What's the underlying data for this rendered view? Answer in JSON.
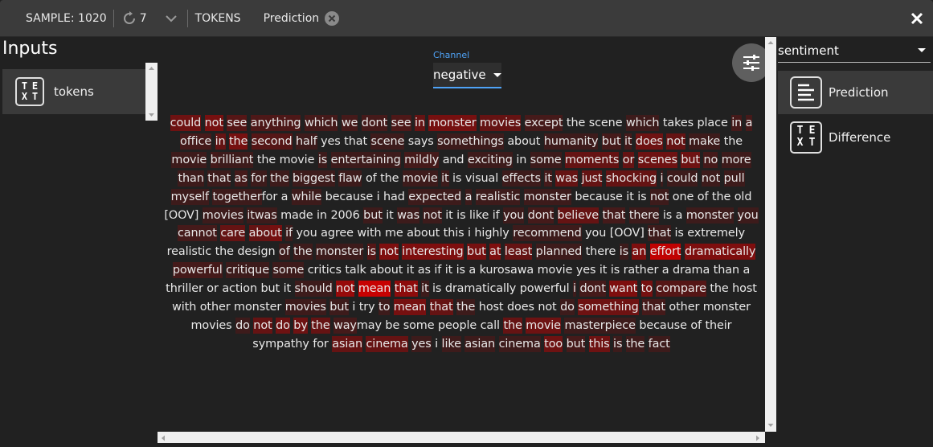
{
  "topbar": {
    "sample": "SAMPLE: 1020",
    "refresh_count": "7",
    "tokens_label": "TOKENS",
    "prediction_label": "Prediction"
  },
  "inputs": {
    "title": "Inputs",
    "tokens_icon_letters": [
      "T",
      "E",
      "X",
      "T"
    ],
    "tokens_label": "tokens"
  },
  "channel": {
    "label": "Channel",
    "value": "negative"
  },
  "right": {
    "select_value": "sentiment",
    "prediction_label": "Prediction",
    "difference_label": "Difference"
  },
  "colors": {
    "panel_bg": "#212121",
    "topbar_bg": "#3b3b3b",
    "selected_row": "#3a3a3a",
    "accent": "#4fa3f7",
    "highlight": "#cc0000"
  },
  "tokens": [
    [
      "could",
      0.35
    ],
    [
      " ",
      0
    ],
    [
      "not",
      0.4
    ],
    [
      " ",
      0
    ],
    [
      "see",
      0.2
    ],
    [
      " ",
      0
    ],
    [
      "anything",
      0.15
    ],
    [
      " ",
      0
    ],
    [
      "which",
      0.1
    ],
    [
      " ",
      0
    ],
    [
      "we",
      0.1
    ],
    [
      " ",
      0
    ],
    [
      "dont",
      0.1
    ],
    [
      " ",
      0
    ],
    [
      "see",
      0.15
    ],
    [
      " ",
      0
    ],
    [
      "in",
      0.3
    ],
    [
      " ",
      0
    ],
    [
      "monster",
      0.4
    ],
    [
      " ",
      0
    ],
    [
      "movies",
      0.3
    ],
    [
      " ",
      0
    ],
    [
      "except",
      0.1
    ],
    [
      " ",
      0
    ],
    [
      "the",
      0
    ],
    [
      " ",
      0
    ],
    [
      "scene",
      0
    ],
    [
      " ",
      0
    ],
    [
      "which",
      0.05
    ],
    [
      " ",
      0
    ],
    [
      "takes",
      0
    ],
    [
      " ",
      0
    ],
    [
      "place",
      0
    ],
    [
      " ",
      0
    ],
    [
      "in",
      0.1
    ],
    [
      " ",
      0
    ],
    [
      "a",
      0.1
    ],
    [
      " ",
      0
    ],
    [
      "of",
      0.1
    ],
    [
      "fice",
      0.1
    ],
    [
      " ",
      0
    ],
    [
      "in",
      0.3
    ],
    [
      " ",
      0
    ],
    [
      "the",
      0.4
    ],
    [
      " ",
      0
    ],
    [
      "second",
      0.2
    ],
    [
      " ",
      0
    ],
    [
      "half",
      0.05
    ],
    [
      " ",
      0
    ],
    [
      "yes",
      0
    ],
    [
      " ",
      0
    ],
    [
      "that",
      0
    ],
    [
      " ",
      0
    ],
    [
      "scene",
      0.05
    ],
    [
      " ",
      0
    ],
    [
      "says",
      0
    ],
    [
      " ",
      0
    ],
    [
      "somethings",
      0.05
    ],
    [
      " ",
      0
    ],
    [
      "about",
      0
    ],
    [
      " ",
      0
    ],
    [
      "humanity",
      0.05
    ],
    [
      " ",
      0
    ],
    [
      "but",
      0.1
    ],
    [
      " ",
      0
    ],
    [
      "it",
      0.1
    ],
    [
      " ",
      0
    ],
    [
      "does",
      0.35
    ],
    [
      " ",
      0
    ],
    [
      "not",
      0.3
    ],
    [
      " ",
      0
    ],
    [
      "make",
      0.05
    ],
    [
      " ",
      0
    ],
    [
      "the",
      0
    ],
    [
      " ",
      0
    ],
    [
      "movie",
      0.05
    ],
    [
      " ",
      0
    ],
    [
      "b",
      0.1
    ],
    [
      "rilliant",
      0.05
    ],
    [
      " ",
      0
    ],
    [
      "the",
      0
    ],
    [
      " ",
      0
    ],
    [
      "movie",
      0
    ],
    [
      " ",
      0
    ],
    [
      "is",
      0.05
    ],
    [
      " ",
      0
    ],
    [
      "entertaining",
      0.05
    ],
    [
      " ",
      0
    ],
    [
      "mildly",
      0.1
    ],
    [
      " ",
      0
    ],
    [
      "and",
      0
    ],
    [
      " ",
      0
    ],
    [
      "exciting",
      0.05
    ],
    [
      " ",
      0
    ],
    [
      "in",
      0
    ],
    [
      " ",
      0
    ],
    [
      "some",
      0.05
    ],
    [
      " ",
      0
    ],
    [
      "moments",
      0.3
    ],
    [
      " ",
      0
    ],
    [
      "or",
      0.3
    ],
    [
      " ",
      0
    ],
    [
      "scenes",
      0.35
    ],
    [
      " ",
      0
    ],
    [
      "but",
      0.35
    ],
    [
      " ",
      0
    ],
    [
      "no",
      0.1
    ],
    [
      " ",
      0
    ],
    [
      "more",
      0.05
    ],
    [
      " ",
      0
    ],
    [
      "than",
      0.05
    ],
    [
      " ",
      0
    ],
    [
      "that",
      0.05
    ],
    [
      " ",
      0
    ],
    [
      "a",
      0.1
    ],
    [
      "s",
      0.1
    ],
    [
      " ",
      0
    ],
    [
      "for",
      0.05
    ],
    [
      " ",
      0
    ],
    [
      "the",
      0.05
    ],
    [
      " ",
      0
    ],
    [
      "biggest",
      0.05
    ],
    [
      " ",
      0
    ],
    [
      "flaw",
      0.05
    ],
    [
      " ",
      0
    ],
    [
      "of",
      0
    ],
    [
      " ",
      0
    ],
    [
      "the",
      0
    ],
    [
      " ",
      0
    ],
    [
      "movie",
      0.05
    ],
    [
      " ",
      0
    ],
    [
      "it",
      0.05
    ],
    [
      " ",
      0
    ],
    [
      "is",
      0
    ],
    [
      " ",
      0
    ],
    [
      "visual",
      0
    ],
    [
      " ",
      0
    ],
    [
      "effects",
      0.05
    ],
    [
      " ",
      0
    ],
    [
      "it",
      0.1
    ],
    [
      " ",
      0
    ],
    [
      "was",
      0.3
    ],
    [
      " ",
      0
    ],
    [
      "just",
      0.3
    ],
    [
      " ",
      0
    ],
    [
      "shocking",
      0.3
    ],
    [
      " ",
      0
    ],
    [
      "i",
      0.05
    ],
    [
      " ",
      0
    ],
    [
      "could",
      0.05
    ],
    [
      " ",
      0
    ],
    [
      "not",
      0.05
    ],
    [
      " ",
      0
    ],
    [
      "pull",
      0.05
    ],
    [
      " ",
      0
    ],
    [
      "myself",
      0.05
    ],
    [
      " ",
      0
    ],
    [
      "together",
      0.05
    ],
    [
      "for",
      0
    ],
    [
      " ",
      0
    ],
    [
      "a",
      0
    ],
    [
      " ",
      0
    ],
    [
      "while",
      0.05
    ],
    [
      " ",
      0
    ],
    [
      "because",
      0
    ],
    [
      " ",
      0
    ],
    [
      "i",
      0
    ],
    [
      " ",
      0
    ],
    [
      "had",
      0
    ],
    [
      " ",
      0
    ],
    [
      "expected",
      0.05
    ],
    [
      " ",
      0
    ],
    [
      "a",
      0.05
    ],
    [
      " ",
      0
    ],
    [
      "realistic",
      0.05
    ],
    [
      " ",
      0
    ],
    [
      "monster",
      0.05
    ],
    [
      " ",
      0
    ],
    [
      "because",
      0
    ],
    [
      " ",
      0
    ],
    [
      "it",
      0
    ],
    [
      " ",
      0
    ],
    [
      "is",
      0
    ],
    [
      " ",
      0
    ],
    [
      "not",
      0.05
    ],
    [
      " ",
      0
    ],
    [
      "one",
      0
    ],
    [
      " ",
      0
    ],
    [
      "of",
      0
    ],
    [
      " ",
      0
    ],
    [
      "the",
      0
    ],
    [
      " ",
      0
    ],
    [
      "old",
      0
    ],
    [
      " ",
      0
    ],
    [
      "[OOV]",
      0
    ],
    [
      " ",
      0
    ],
    [
      "movies",
      0.05
    ],
    [
      " ",
      0
    ],
    [
      "it",
      0.05
    ],
    [
      "was",
      0.05
    ],
    [
      " ",
      0
    ],
    [
      "made",
      0
    ],
    [
      " ",
      0
    ],
    [
      "in",
      0
    ],
    [
      " ",
      0
    ],
    [
      "2006",
      0
    ],
    [
      " ",
      0
    ],
    [
      "but",
      0.05
    ],
    [
      " ",
      0
    ],
    [
      "it",
      0
    ],
    [
      " ",
      0
    ],
    [
      "was",
      0.05
    ],
    [
      " ",
      0
    ],
    [
      "not",
      0.05
    ],
    [
      " ",
      0
    ],
    [
      "it",
      0
    ],
    [
      " ",
      0
    ],
    [
      "is",
      0
    ],
    [
      " ",
      0
    ],
    [
      "like",
      0
    ],
    [
      " ",
      0
    ],
    [
      "if",
      0
    ],
    [
      " ",
      0
    ],
    [
      "you",
      0.05
    ],
    [
      " ",
      0
    ],
    [
      "dont",
      0.1
    ],
    [
      " ",
      0
    ],
    [
      "believe",
      0.3
    ],
    [
      " ",
      0
    ],
    [
      "that",
      0.1
    ],
    [
      " ",
      0
    ],
    [
      "there",
      0.05
    ],
    [
      " ",
      0
    ],
    [
      "is",
      0
    ],
    [
      " ",
      0
    ],
    [
      "a",
      0
    ],
    [
      " ",
      0
    ],
    [
      "monster",
      0.05
    ],
    [
      " ",
      0
    ],
    [
      "you",
      0.05
    ],
    [
      " ",
      0
    ],
    [
      "cannot",
      0.1
    ],
    [
      " ",
      0
    ],
    [
      "care",
      0.3
    ],
    [
      " ",
      0
    ],
    [
      "abo",
      0.3
    ],
    [
      "ut",
      0.4
    ],
    [
      " ",
      0
    ],
    [
      "if",
      0.05
    ],
    [
      " ",
      0
    ],
    [
      "you",
      0
    ],
    [
      " ",
      0
    ],
    [
      "agree",
      0
    ],
    [
      " ",
      0
    ],
    [
      "with",
      0
    ],
    [
      " ",
      0
    ],
    [
      "me",
      0
    ],
    [
      " ",
      0
    ],
    [
      "about",
      0
    ],
    [
      " ",
      0
    ],
    [
      "this",
      0
    ],
    [
      " ",
      0
    ],
    [
      "i",
      0
    ],
    [
      " ",
      0
    ],
    [
      "highly",
      0
    ],
    [
      " ",
      0
    ],
    [
      "recommend",
      0.05
    ],
    [
      " ",
      0
    ],
    [
      "you",
      0
    ],
    [
      " ",
      0
    ],
    [
      "[OOV]",
      0
    ],
    [
      " ",
      0
    ],
    [
      "that",
      0.05
    ],
    [
      " ",
      0
    ],
    [
      "is",
      0
    ],
    [
      " ",
      0
    ],
    [
      "extremely",
      0
    ],
    [
      " ",
      0
    ],
    [
      "realistic",
      0
    ],
    [
      " ",
      0
    ],
    [
      "the",
      0
    ],
    [
      " ",
      0
    ],
    [
      "design",
      0
    ],
    [
      " ",
      0
    ],
    [
      "o",
      0.05
    ],
    [
      "f",
      0.05
    ],
    [
      " ",
      0
    ],
    [
      "the",
      0.05
    ],
    [
      " ",
      0
    ],
    [
      "monster",
      0.05
    ],
    [
      " ",
      0
    ],
    [
      "is",
      0.2
    ],
    [
      " ",
      0
    ],
    [
      "not",
      0.45
    ],
    [
      " ",
      0
    ],
    [
      "interesting",
      0.45
    ],
    [
      " ",
      0
    ],
    [
      "but",
      0.4
    ],
    [
      " ",
      0
    ],
    [
      "at",
      0.45
    ],
    [
      " ",
      0
    ],
    [
      "least",
      0.3
    ],
    [
      " ",
      0
    ],
    [
      "planned",
      0.05
    ],
    [
      " ",
      0
    ],
    [
      "there",
      0
    ],
    [
      " ",
      0
    ],
    [
      "is",
      0.05
    ],
    [
      " ",
      0
    ],
    [
      "an",
      0.45
    ],
    [
      " ",
      0
    ],
    [
      "effort",
      0.85
    ],
    [
      " ",
      0
    ],
    [
      "dramatically",
      0.45
    ],
    [
      " ",
      0
    ],
    [
      "powerful",
      0.1
    ],
    [
      " ",
      0
    ],
    [
      "critique",
      0.05
    ],
    [
      " ",
      0
    ],
    [
      "som",
      0.05
    ],
    [
      "e",
      0.05
    ],
    [
      " ",
      0
    ],
    [
      "critics",
      0
    ],
    [
      " ",
      0
    ],
    [
      "talk",
      0
    ],
    [
      " ",
      0
    ],
    [
      "about",
      0
    ],
    [
      " ",
      0
    ],
    [
      "it",
      0
    ],
    [
      " ",
      0
    ],
    [
      "as",
      0
    ],
    [
      " ",
      0
    ],
    [
      "if",
      0
    ],
    [
      " ",
      0
    ],
    [
      "it",
      0
    ],
    [
      " ",
      0
    ],
    [
      "is",
      0
    ],
    [
      " ",
      0
    ],
    [
      "a",
      0
    ],
    [
      " ",
      0
    ],
    [
      "kurosawa",
      0
    ],
    [
      " ",
      0
    ],
    [
      "movie",
      0
    ],
    [
      " ",
      0
    ],
    [
      "yes",
      0
    ],
    [
      " ",
      0
    ],
    [
      "it",
      0
    ],
    [
      " ",
      0
    ],
    [
      "is",
      0
    ],
    [
      " ",
      0
    ],
    [
      "rather",
      0
    ],
    [
      " ",
      0
    ],
    [
      "a",
      0
    ],
    [
      " ",
      0
    ],
    [
      "drama",
      0
    ],
    [
      " ",
      0
    ],
    [
      "than",
      0
    ],
    [
      " ",
      0
    ],
    [
      "a",
      0
    ],
    [
      " ",
      0
    ],
    [
      "thriller",
      0
    ],
    [
      " ",
      0
    ],
    [
      "or",
      0
    ],
    [
      " ",
      0
    ],
    [
      "action",
      0
    ],
    [
      " ",
      0
    ],
    [
      "but",
      0
    ],
    [
      " ",
      0
    ],
    [
      "it",
      0
    ],
    [
      " ",
      0
    ],
    [
      "sho",
      0.05
    ],
    [
      "uld",
      0.05
    ],
    [
      " ",
      0
    ],
    [
      "not",
      0.6
    ],
    [
      " ",
      0
    ],
    [
      "mean",
      0.9
    ],
    [
      " ",
      0
    ],
    [
      "that",
      0.55
    ],
    [
      " ",
      0
    ],
    [
      "it",
      0.05
    ],
    [
      " ",
      0
    ],
    [
      "is",
      0
    ],
    [
      " ",
      0
    ],
    [
      "dramatically",
      0
    ],
    [
      " ",
      0
    ],
    [
      "powerful",
      0
    ],
    [
      " ",
      0
    ],
    [
      "i",
      0.05
    ],
    [
      " ",
      0
    ],
    [
      "dont",
      0.1
    ],
    [
      " ",
      0
    ],
    [
      "want",
      0.45
    ],
    [
      " ",
      0
    ],
    [
      "to",
      0.4
    ],
    [
      " ",
      0
    ],
    [
      "compare",
      0.2
    ],
    [
      " ",
      0
    ],
    [
      "the",
      0
    ],
    [
      " ",
      0
    ],
    [
      "host",
      0
    ],
    [
      " ",
      0
    ],
    [
      "with",
      0
    ],
    [
      " ",
      0
    ],
    [
      "other",
      0
    ],
    [
      " ",
      0
    ],
    [
      "monster",
      0
    ],
    [
      " ",
      0
    ],
    [
      "movie",
      0.05
    ],
    [
      "s",
      0.05
    ],
    [
      " ",
      0
    ],
    [
      "but",
      0.05
    ],
    [
      " ",
      0
    ],
    [
      "i",
      0
    ],
    [
      " ",
      0
    ],
    [
      "try",
      0
    ],
    [
      " ",
      0
    ],
    [
      "to",
      0.05
    ],
    [
      " ",
      0
    ],
    [
      "mean",
      0.4
    ],
    [
      " ",
      0
    ],
    [
      "that",
      0.3
    ],
    [
      " ",
      0
    ],
    [
      "the",
      0.05
    ],
    [
      " ",
      0
    ],
    [
      "host",
      0
    ],
    [
      " ",
      0
    ],
    [
      "does",
      0
    ],
    [
      " ",
      0
    ],
    [
      "not",
      0
    ],
    [
      " ",
      0
    ],
    [
      "do",
      0.05
    ],
    [
      " ",
      0
    ],
    [
      "something",
      0.35
    ],
    [
      " ",
      0
    ],
    [
      "that",
      0.1
    ],
    [
      " ",
      0
    ],
    [
      "other",
      0
    ],
    [
      " ",
      0
    ],
    [
      "monster",
      0
    ],
    [
      " ",
      0
    ],
    [
      "movies",
      0
    ],
    [
      " ",
      0
    ],
    [
      "do",
      0.05
    ],
    [
      " ",
      0
    ],
    [
      "not",
      0.3
    ],
    [
      " ",
      0
    ],
    [
      "do",
      0.35
    ],
    [
      " ",
      0
    ],
    [
      "by",
      0.35
    ],
    [
      " ",
      0
    ],
    [
      "the",
      0.3
    ],
    [
      " ",
      0
    ],
    [
      "way",
      0.1
    ],
    [
      "may",
      0
    ],
    [
      " ",
      0
    ],
    [
      "be",
      0
    ],
    [
      " ",
      0
    ],
    [
      "some",
      0
    ],
    [
      " ",
      0
    ],
    [
      "people",
      0
    ],
    [
      " ",
      0
    ],
    [
      "call",
      0
    ],
    [
      " ",
      0
    ],
    [
      "the",
      0.3
    ],
    [
      " ",
      0
    ],
    [
      "movie",
      0.35
    ],
    [
      " ",
      0
    ],
    [
      "masterpiece",
      0.05
    ],
    [
      " ",
      0
    ],
    [
      "because",
      0
    ],
    [
      " ",
      0
    ],
    [
      "of",
      0
    ],
    [
      " ",
      0
    ],
    [
      "their",
      0
    ],
    [
      " ",
      0
    ],
    [
      "sympathy",
      0
    ],
    [
      " ",
      0
    ],
    [
      "for",
      0
    ],
    [
      " ",
      0
    ],
    [
      "asian",
      0.3
    ],
    [
      " ",
      0
    ],
    [
      "cinema",
      0.3
    ],
    [
      " ",
      0
    ],
    [
      "yes",
      0.05
    ],
    [
      " ",
      0
    ],
    [
      "i",
      0
    ],
    [
      " ",
      0
    ],
    [
      "like",
      0.05
    ],
    [
      " ",
      0
    ],
    [
      "a",
      0.05
    ],
    [
      "sian",
      0.05
    ],
    [
      " ",
      0
    ],
    [
      "cinema",
      0.05
    ],
    [
      " ",
      0
    ],
    [
      "too",
      0.35
    ],
    [
      " ",
      0
    ],
    [
      "but",
      0.1
    ],
    [
      " ",
      0
    ],
    [
      "this",
      0.35
    ],
    [
      " ",
      0
    ],
    [
      "is",
      0.05
    ],
    [
      " ",
      0
    ],
    [
      "the",
      0.05
    ],
    [
      " ",
      0
    ],
    [
      "fact",
      0.05
    ]
  ]
}
